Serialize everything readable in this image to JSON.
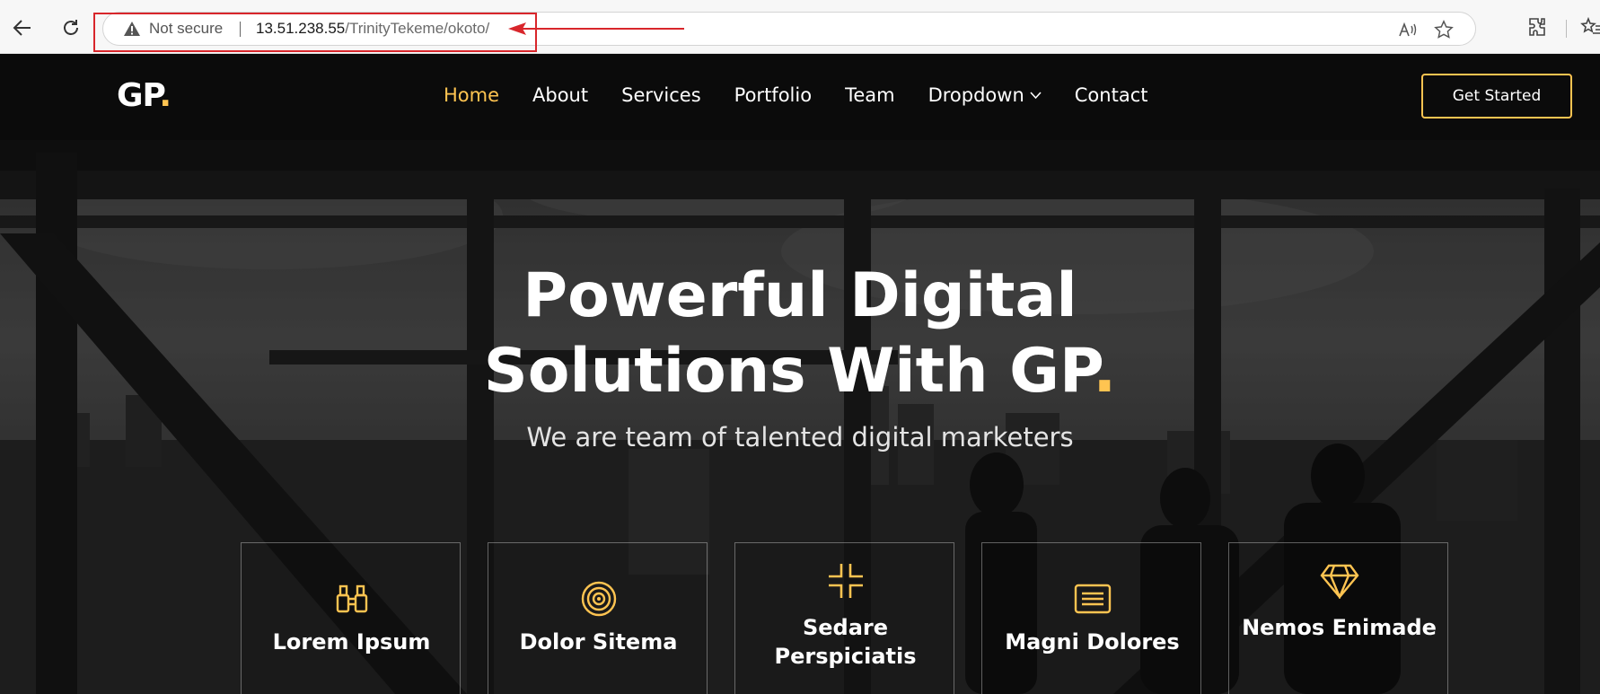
{
  "browser": {
    "security_label": "Not secure",
    "url_host": "13.51.238.55",
    "url_path": "/TrinityTekeme/okoto/",
    "icons": [
      "back-arrow-icon",
      "reload-icon",
      "warning-icon",
      "read-aloud-icon",
      "favorite-star-icon",
      "extensions-icon",
      "favorites-list-icon"
    ]
  },
  "annotation": {
    "box_color": "#d8262b",
    "arrow_color": "#d8262b"
  },
  "site": {
    "logo": {
      "text": "GP",
      "dot": "."
    },
    "nav": {
      "items": [
        "Home",
        "About",
        "Services",
        "Portfolio",
        "Team",
        "Dropdown",
        "Contact"
      ],
      "active": "Home"
    },
    "cta_label": "Get Started",
    "hero": {
      "title_line1": "Powerful Digital",
      "title_line2": "Solutions With GP",
      "title_dot": ".",
      "subtitle": "We are team of talented digital marketers"
    },
    "cards": [
      {
        "title": "Lorem Ipsum",
        "icon": "binoculars-icon"
      },
      {
        "title": "Dolor Sitema",
        "icon": "target-icon"
      },
      {
        "title": "Sedare Perspiciatis",
        "icon": "minimize-arrows-icon"
      },
      {
        "title": "Magni Dolores",
        "icon": "list-card-icon"
      },
      {
        "title": "Nemos Enimade",
        "icon": "gem-icon"
      }
    ],
    "colors": {
      "accent": "#ffc451",
      "text": "#ffffff",
      "background": "#1c1c1c"
    }
  }
}
